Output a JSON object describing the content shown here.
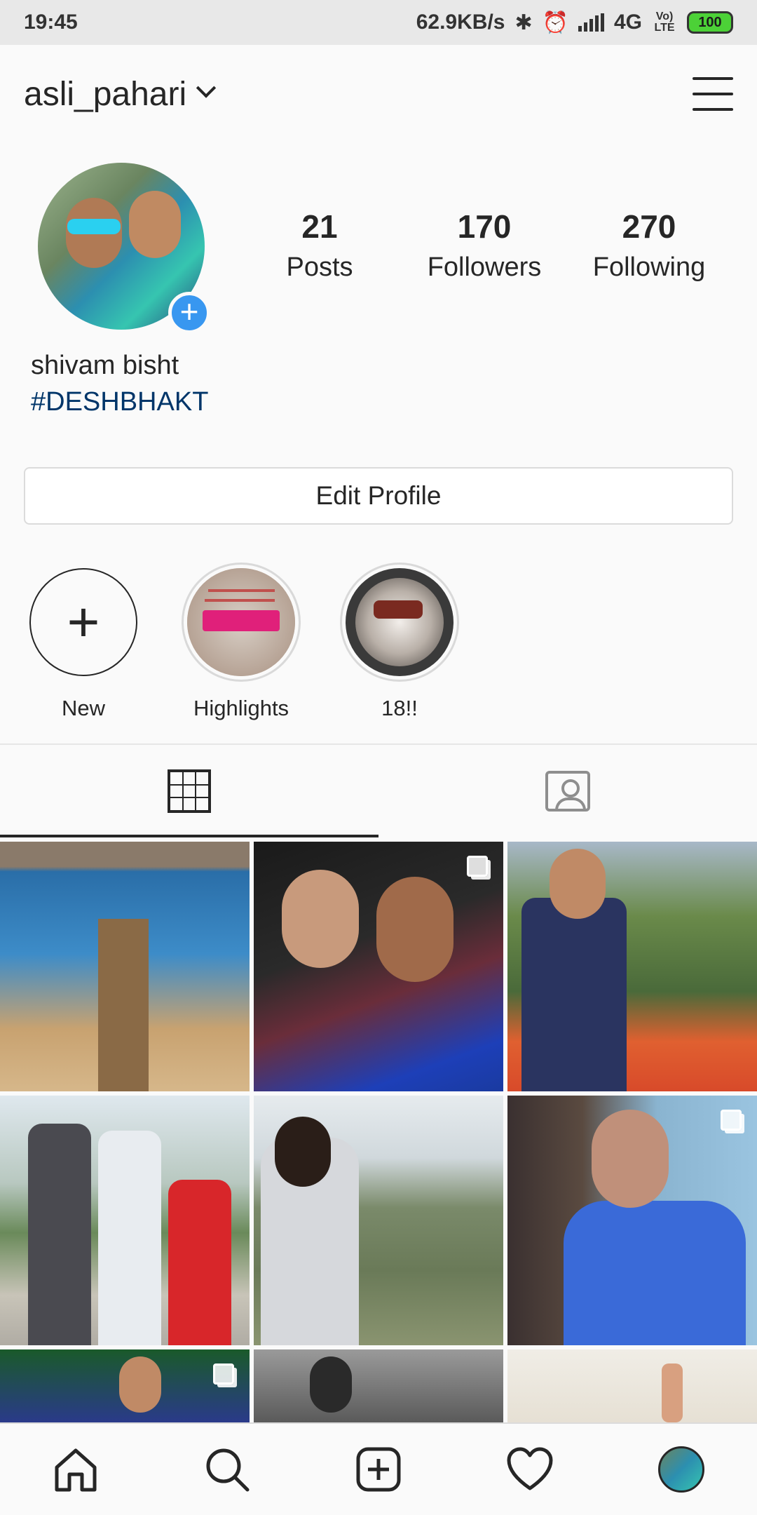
{
  "status_bar": {
    "time": "19:45",
    "speed": "62.9KB/s",
    "network": "4G",
    "volte": "Vo) LTE",
    "battery": "100"
  },
  "header": {
    "username": "asli_pahari"
  },
  "profile": {
    "stats": [
      {
        "value": "21",
        "label": "Posts"
      },
      {
        "value": "170",
        "label": "Followers"
      },
      {
        "value": "270",
        "label": "Following"
      }
    ],
    "full_name": "shivam bisht",
    "bio": "#DESHBHAKT",
    "edit_button": "Edit Profile"
  },
  "highlights": [
    {
      "label": "New"
    },
    {
      "label": "Highlights"
    },
    {
      "label": "18!!"
    }
  ],
  "icons": {
    "grid_tab": "grid-icon",
    "tagged_tab": "tagged-icon",
    "nav": [
      "home-icon",
      "search-icon",
      "add-post-icon",
      "heart-icon",
      "profile-avatar"
    ]
  }
}
